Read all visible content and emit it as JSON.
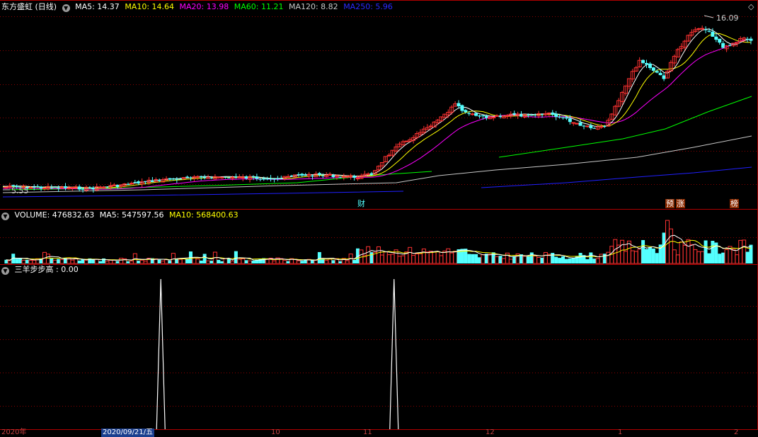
{
  "header": {
    "title": "东方盛虹 (日线)",
    "ma5": "MA5: 14.37",
    "ma10": "MA10: 14.64",
    "ma20": "MA20: 13.98",
    "ma60": "MA60: 11.21",
    "ma120": "MA120: 8.82",
    "ma250": "MA250: 5.96"
  },
  "price_panel": {
    "high_label": "16.09",
    "low_label": "5.55",
    "markers": [
      "财",
      "预",
      "涨",
      "榜"
    ]
  },
  "volume_panel": {
    "volume": "VOLUME: 476832.63",
    "ma5": "MA5: 547597.56",
    "ma10": "MA10: 568400.63"
  },
  "indicator_panel": {
    "label": "三羊步步高 : 0.00"
  },
  "xaxis": {
    "left": "2020年",
    "selected_date": "2020/09/21/五",
    "ticks": [
      "10",
      "11",
      "12",
      "1",
      "2"
    ]
  },
  "colors": {
    "up": "#ff3232",
    "down": "#54ffff",
    "ma5": "#ffffff",
    "ma10": "#ffff00",
    "ma20": "#ff00ff",
    "ma60": "#00ff00",
    "ma120": "#c8c8c8",
    "ma250": "#2020ff",
    "grid": "#8b0000",
    "divider": "#b00000"
  },
  "indicator_spikes": [
    0.21,
    0.52
  ]
}
